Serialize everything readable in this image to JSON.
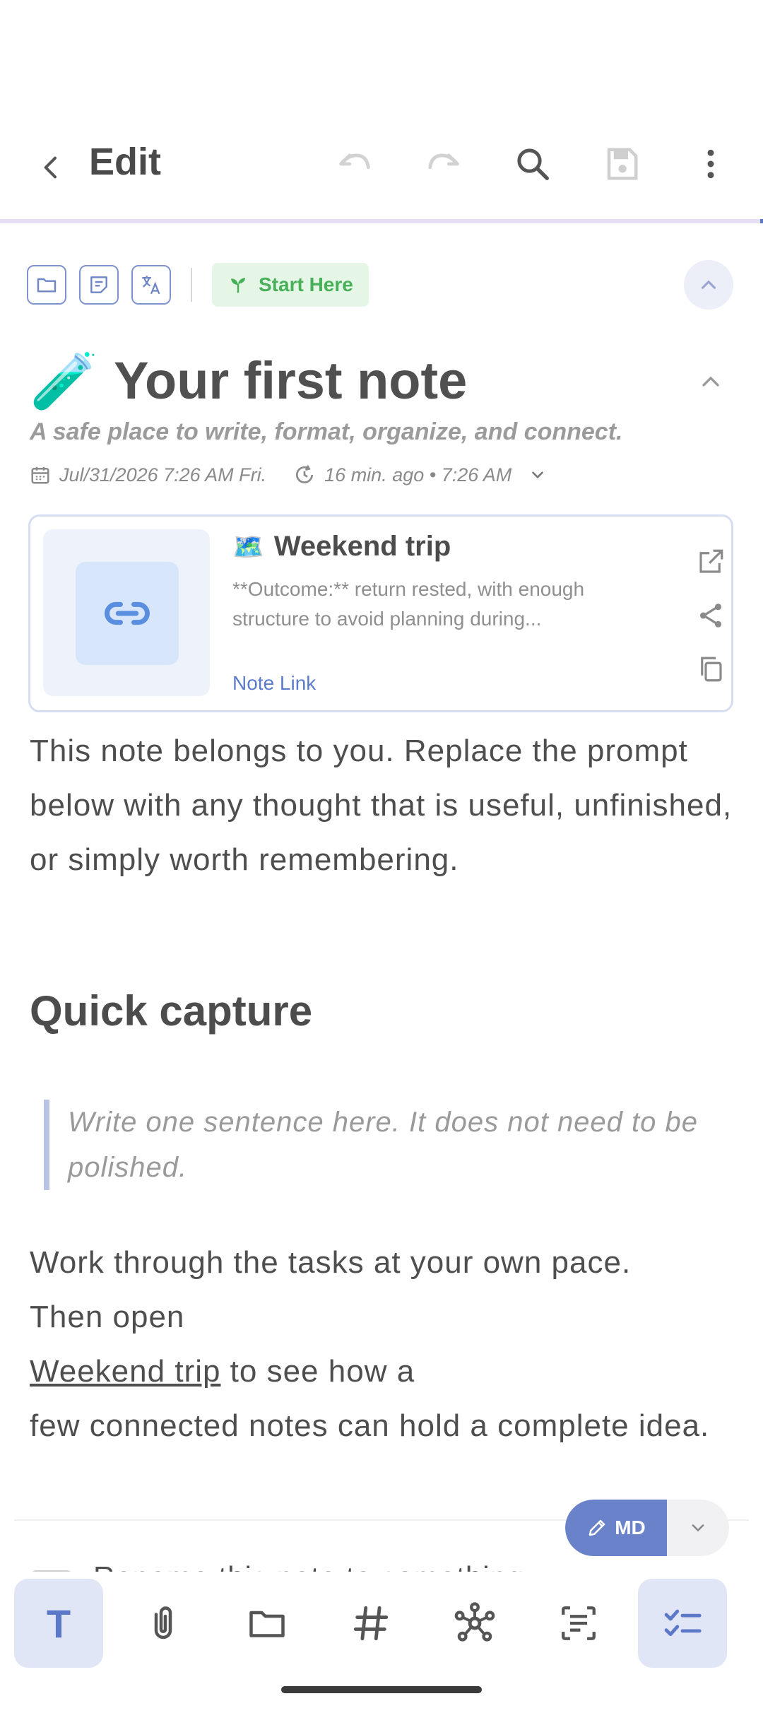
{
  "header": {
    "title": "Edit",
    "icons": [
      "back-arrow-icon",
      "undo-icon",
      "redo-icon",
      "search-icon",
      "save-icon",
      "more-vert-icon"
    ]
  },
  "tags": {
    "start_chip_label": "Start Here",
    "icons": [
      "folder-icon",
      "note-icon",
      "translate-icon",
      "sprout-icon"
    ]
  },
  "note": {
    "emoji": "🧪",
    "title": "Your first note",
    "subtitle": "A safe place to write, format, organize, and connect.",
    "created": "Jul/31/2026 7:26 AM Fri.",
    "modified": "16 min. ago • 7:26 AM"
  },
  "link_card": {
    "emoji": "🗺️",
    "title": "Weekend trip",
    "description": "**Outcome:** return rested, with enough structure to avoid planning during...",
    "type_label": "Note Link"
  },
  "body": {
    "para1": "This note belongs to you. Replace the prompt below with any thought that is useful, unfinished, or simply worth remembering.",
    "heading": "Quick capture",
    "quote": "Write one sentence here. It does not need to be polished.",
    "para2_a": "Work through the tasks at your own pace.",
    "para2_b": "Then open",
    "link_text": "Weekend trip",
    "para2_c": " to see how a",
    "para2_d": "few connected notes can hold a complete idea.",
    "todo_text": "Rename this note to something"
  },
  "md_toggle": {
    "label": "MD"
  },
  "toolbar": {
    "items": [
      "text-format-icon",
      "attachment-icon",
      "folder-icon",
      "hashtag-icon",
      "graph-icon",
      "list-scan-icon",
      "checklist-icon"
    ],
    "text_label": "T"
  },
  "colors": {
    "accent": "#6a82c9",
    "chip_green": "#49b05a",
    "link_blue": "#5b7ccb"
  }
}
